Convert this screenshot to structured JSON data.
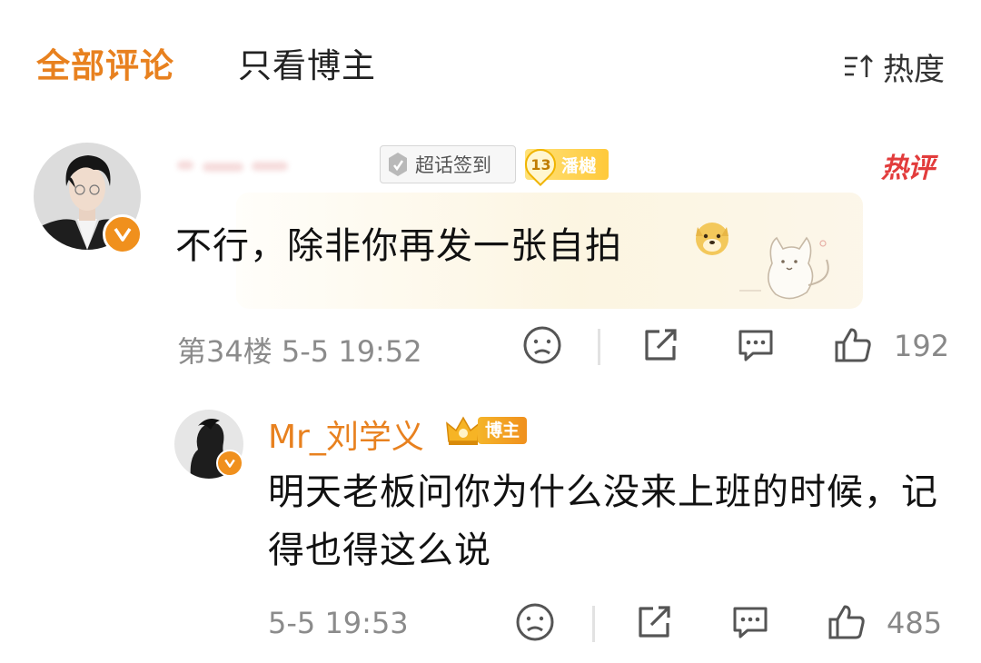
{
  "tabs": {
    "all": "全部评论",
    "owner_only": "只看博主",
    "sort_label": "热度"
  },
  "comment1": {
    "badge_chaohua": "超话签到",
    "badge_level": "13",
    "badge_fan_name": "潘樾",
    "hot_badge": "热评",
    "text": "不行，除非你再发一张自拍",
    "meta": "第34楼 5-5 19:52",
    "likes": "192"
  },
  "reply": {
    "username": "Mr_刘学义",
    "badge": "博主",
    "text": "明天老板问你为什么没来上班的时候，记得也得这么说",
    "meta": "5-5 19:53",
    "likes": "485"
  },
  "colors": {
    "accent": "#e8811f",
    "hot": "#e23c3c",
    "meta": "#8b8b8b",
    "verified": "#f0901d"
  },
  "icons": [
    "sort-icon",
    "chaohua-icon",
    "level-icon",
    "doge-emoji",
    "cat-sticker",
    "dislike-face-icon",
    "share-icon",
    "comment-icon",
    "like-icon",
    "crown-icon",
    "verified-icon"
  ]
}
